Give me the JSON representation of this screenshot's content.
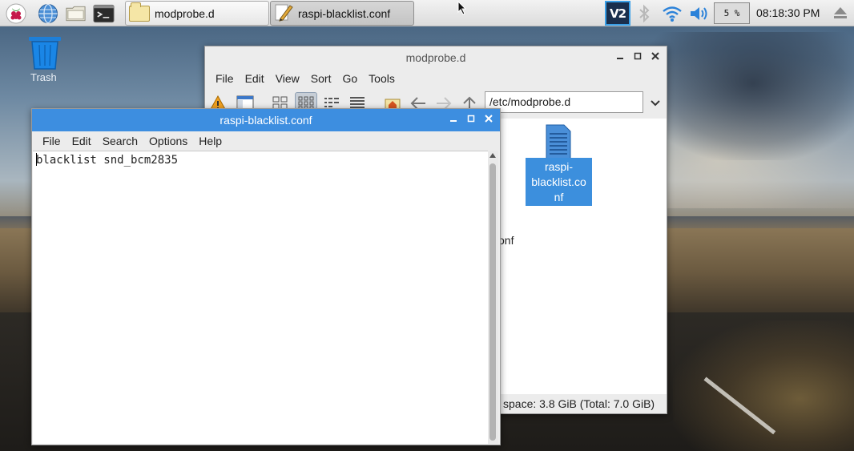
{
  "taskbar": {
    "launchers": [
      {
        "icon": "raspberry-menu-icon"
      },
      {
        "icon": "web-browser-icon"
      },
      {
        "icon": "file-manager-icon"
      },
      {
        "icon": "terminal-icon"
      }
    ],
    "tasks": [
      {
        "label": "modprobe.d",
        "icon": "folder-icon",
        "active": false
      },
      {
        "label": "raspi-blacklist.conf",
        "icon": "text-editor-icon",
        "active": true
      }
    ],
    "tray": {
      "vnc_label": "V2",
      "bluetooth_icon": "bluetooth-icon",
      "wifi_icon": "wifi-icon",
      "volume_icon": "volume-icon",
      "cpu_usage": "5 %",
      "clock": "08:18:30 PM",
      "eject_icon": "eject-icon"
    }
  },
  "desktop": {
    "trash_label": "Trash"
  },
  "file_manager": {
    "title": "modprobe.d",
    "menu": [
      "File",
      "Edit",
      "View",
      "Sort",
      "Go",
      "Tools"
    ],
    "path": "/etc/modprobe.d",
    "partial_file_label": "onf",
    "selected_file": {
      "label_lines": [
        "raspi-",
        "blacklist.co",
        "nf"
      ]
    },
    "status": "space: 3.8 GiB (Total: 7.0 GiB)"
  },
  "editor": {
    "title": "raspi-blacklist.conf",
    "menu": [
      "File",
      "Edit",
      "Search",
      "Options",
      "Help"
    ],
    "content": "blacklist snd_bcm2835"
  },
  "colors": {
    "editor_titlebar": "#3d8ee0",
    "selection": "#3c8fdd"
  }
}
